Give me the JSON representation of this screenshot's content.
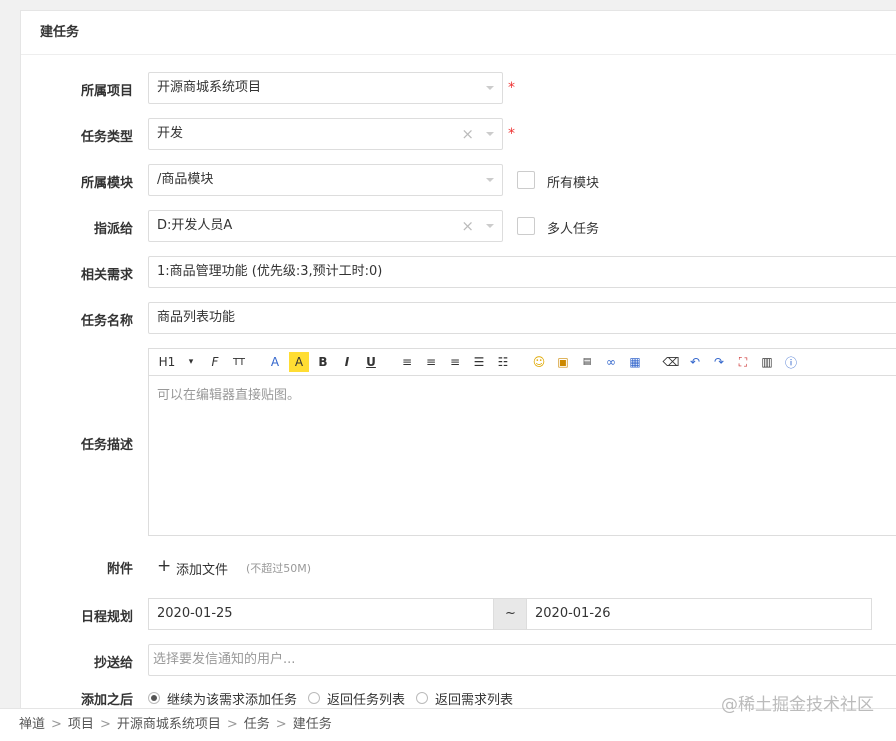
{
  "panel": {
    "title": "建任务"
  },
  "form": {
    "project": {
      "label": "所属项目",
      "value": "开源商城系统项目",
      "required": "*"
    },
    "type": {
      "label": "任务类型",
      "value": "开发",
      "required": "*"
    },
    "module": {
      "label": "所属模块",
      "value": "/商品模块",
      "checkbox_label": "所有模块"
    },
    "assign": {
      "label": "指派给",
      "value": "D:开发人员A",
      "checkbox_label": "多人任务"
    },
    "story": {
      "label": "相关需求",
      "value": "1:商品管理功能 (优先级:3,预计工时:0)"
    },
    "name": {
      "label": "任务名称",
      "value": "商品列表功能"
    },
    "desc": {
      "label": "任务描述",
      "placeholder": "可以在编辑器直接贴图。"
    },
    "files": {
      "label": "附件",
      "add_label": "添加文件",
      "hint": "(不超过50M)"
    },
    "schedule": {
      "label": "日程规划",
      "start": "2020-01-25",
      "separator": "~",
      "end": "2020-01-26"
    },
    "mailto": {
      "label": "抄送给",
      "placeholder": "选择要发信通知的用户..."
    },
    "after": {
      "label": "添加之后",
      "options": [
        "继续为该需求添加任务",
        "返回任务列表",
        "返回需求列表"
      ]
    }
  },
  "toolbar": {
    "h1": "H1",
    "font": "F",
    "size": "TT",
    "color": "A",
    "bg": "A",
    "bold": "B",
    "italic": "I",
    "underline": "U"
  },
  "breadcrumb": [
    "禅道",
    "项目",
    "开源商城系统项目",
    "任务",
    "建任务"
  ],
  "watermark": "@稀土掘金技术社区",
  "colors": {
    "required": "#ee3333",
    "border": "#dddddd",
    "tilde_bg": "#e8e8e8"
  }
}
